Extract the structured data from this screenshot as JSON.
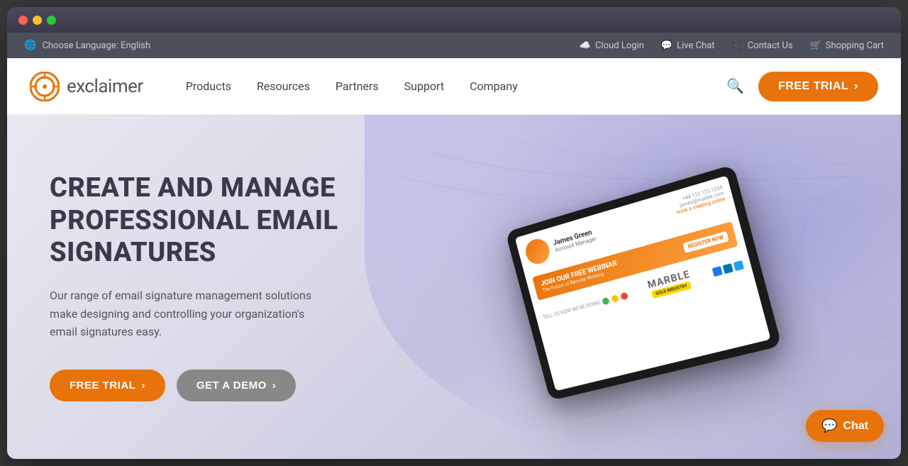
{
  "browser": {
    "dots": [
      "red",
      "yellow",
      "green"
    ]
  },
  "utility_bar": {
    "language_label": "Choose Language: English",
    "cloud_login": "Cloud Login",
    "live_chat": "Live Chat",
    "contact_us": "Contact Us",
    "shopping_cart": "Shopping Cart"
  },
  "nav": {
    "logo_text": "exclaimer",
    "links": [
      "Products",
      "Resources",
      "Partners",
      "Support",
      "Company"
    ],
    "free_trial_btn": "FREE TRIAL"
  },
  "hero": {
    "title_line1": "CREATE AND MANAGE",
    "title_line2": "PROFESSIONAL EMAIL",
    "title_line3": "SIGNATURES",
    "subtitle": "Our range of email signature management solutions make designing and controlling your organization's email signatures easy.",
    "btn_free_trial": "FREE TRIAL",
    "btn_get_demo": "GET A DEMO",
    "tablet": {
      "person_name": "James Green",
      "person_role": "Account Manager",
      "banner_title": "JOIN OUR FREE WEBINAR",
      "banner_sub": "The Future of Remote Working",
      "register_btn": "REGISTER NOW",
      "brand_name": "MARBLE"
    }
  },
  "chat": {
    "label": "Chat"
  },
  "colors": {
    "orange": "#e8730a",
    "dark_text": "#3a3a4a",
    "utility_bg": "#4a4f5a"
  }
}
